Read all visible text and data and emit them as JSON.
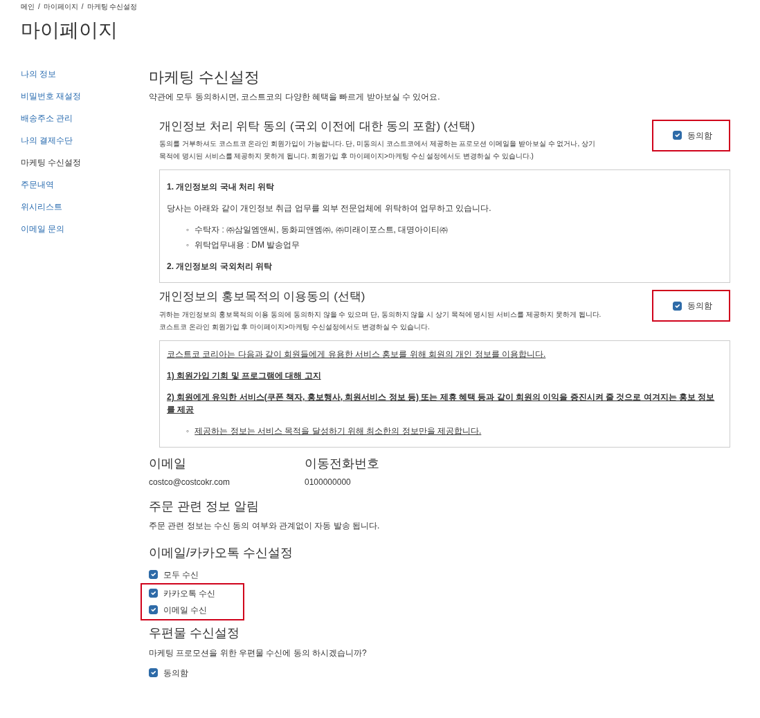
{
  "breadcrumb": {
    "separator": "/",
    "items": [
      "메인",
      "마이페이지",
      "마케팅 수신설정"
    ]
  },
  "page_title": "마이페이지",
  "sidebar": {
    "items": [
      {
        "label": "나의 정보",
        "selected": false
      },
      {
        "label": "비밀번호 재설정",
        "selected": false
      },
      {
        "label": "배송주소 관리",
        "selected": false
      },
      {
        "label": "나의 결제수단",
        "selected": false
      },
      {
        "label": "마케팅 수신설정",
        "selected": true
      },
      {
        "label": "주문내역",
        "selected": false
      },
      {
        "label": "위시리스트",
        "selected": false
      },
      {
        "label": "이메일 문의",
        "selected": false
      }
    ]
  },
  "main": {
    "title": "마케팅 수신설정",
    "intro": "약관에 모두 동의하시면, 코스트코의 다양한 혜택을 빠르게 받아보실 수 있어요.",
    "consents": [
      {
        "title": "개인정보 처리 위탁 동의 (국외 이전에 대한 동의 포함) (선택)",
        "description": "동의를 거부하셔도 코스트코 온라인 회원가입이 가능합니다. 단, 미동의시 코스트코에서 제공하는 프로모션 이메일을 받아보실 수 없거나, 상기 목적에 명시된 서비스를 제공하지 못하게 됩니다. 회원가입 후 마이페이지>마케팅 수신 설정에서도 변경하실 수 있습니다.)",
        "agree_label": "동의함",
        "checked": true,
        "highlighted": true,
        "underlined": false,
        "terms": [
          {
            "kind": "heading",
            "text": "1. 개인정보의 국내 처리 위탁"
          },
          {
            "kind": "paragraph",
            "text": "당사는 아래와 같이 개인정보 취급 업무를 외부 전문업체에 위탁하여 업무하고 있습니다."
          },
          {
            "kind": "bullets",
            "marker": "◦",
            "items": [
              "수탁자 : ㈜삼일엠앤씨, 동화피앤엠㈜, ㈜미래이포스트, 대명아이티㈜",
              "위탁업무내용 : DM 발송업무"
            ]
          },
          {
            "kind": "heading",
            "text": "2. 개인정보의 국외처리 위탁"
          }
        ]
      },
      {
        "title": "개인정보의 홍보목적의 이용동의 (선택)",
        "description": "귀하는 개인정보의 홍보목적의 이용 동의에 동의하지 않을 수 있으며 단, 동의하지 않을 시 상기 목적에 명시된 서비스를 제공하지 못하게 됩니다. 코스트코 온라인 회원가입 후 마이페이지>마케팅 수신설정에서도 변경하실 수 있습니다.",
        "agree_label": "동의함",
        "checked": true,
        "highlighted": true,
        "underlined": true,
        "terms": [
          {
            "kind": "paragraph",
            "text": "코스트코 코리아는 다음과 같이 회원들에게 유용한 서비스 홍보를 위해 회원의 개인 정보를 이용합니다."
          },
          {
            "kind": "heading",
            "text": "1) 회원가입 기회 및 프로그램에 대해 고지"
          },
          {
            "kind": "heading",
            "text": "2) 회원에게 유익한 서비스(쿠폰 책자, 홍보행사, 회원서비스 정보 등) 또는 제휴 혜택 등과 같이 회원의 이익을 증진시켜 줄 것으로 여겨지는 홍보 정보를 제공"
          },
          {
            "kind": "bullets",
            "marker": "◦",
            "items": [
              "제공하는 정보는 서비스 목적을 달성하기 위해 최소한의 정보만을 제공합니다."
            ]
          }
        ]
      }
    ],
    "contacts": [
      {
        "label": "이메일",
        "value": "costco@costcokr.com"
      },
      {
        "label": "이동전화번호",
        "value": "0100000000"
      }
    ],
    "order_notice": {
      "title": "주문 관련 정보 알림",
      "text": "주문 관련 정보는 수신 동의 여부와 관계없이 자동 발송 됩니다."
    },
    "email_kakao": {
      "title": "이메일/카카오톡 수신설정",
      "options": [
        {
          "label": "모두 수신",
          "checked": true,
          "highlighted": false
        },
        {
          "label": "카카오톡 수신",
          "checked": true,
          "highlighted": true
        },
        {
          "label": "이메일 수신",
          "checked": true,
          "highlighted": true
        }
      ]
    },
    "postal": {
      "title": "우편물 수신설정",
      "text": "마케팅 프로모션을 위한 우편물 수신에 동의 하시겠습니까?",
      "option": {
        "label": "동의함",
        "checked": true,
        "highlighted": false
      }
    }
  }
}
